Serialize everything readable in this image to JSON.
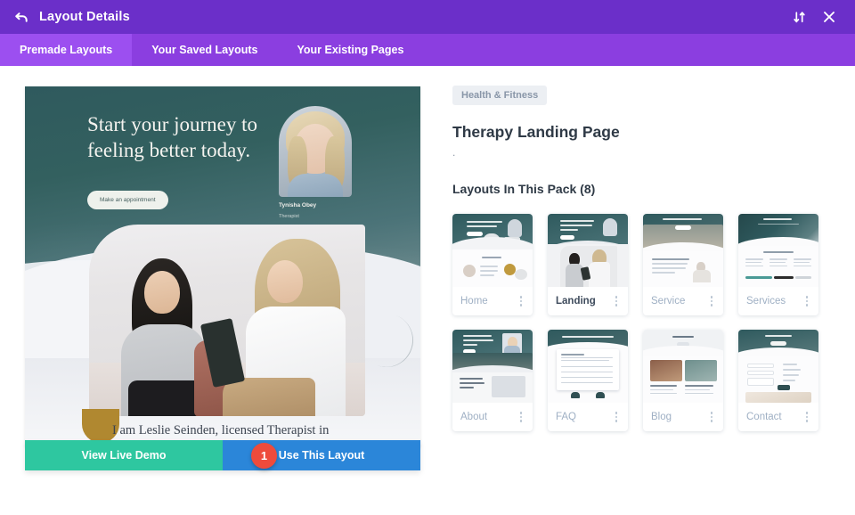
{
  "header": {
    "title": "Layout Details",
    "back_icon": "back-arrow-icon",
    "sort_icon": "sort-updown-icon",
    "close_icon": "close-x-icon",
    "bg_color": "#6b2fc9"
  },
  "tabs": [
    {
      "label": "Premade Layouts",
      "active": true
    },
    {
      "label": "Your Saved Layouts",
      "active": false
    },
    {
      "label": "Your Existing Pages",
      "active": false
    }
  ],
  "preview": {
    "headline": "Start your journey to feeling better today.",
    "cta_label": "Make an appointment",
    "person_name": "Tynisha Obey",
    "person_role": "Therapist",
    "lower_text": "I am Leslie Seinden, licensed Therapist in"
  },
  "actions": {
    "demo_label": "View Live Demo",
    "demo_color": "#2ec7a0",
    "use_label": "Use This Layout",
    "use_color": "#2b86d9",
    "marker_number": "1",
    "marker_color": "#ee4b3c"
  },
  "details": {
    "category": "Health & Fitness",
    "title": "Therapy Landing Page",
    "description": ".",
    "pack_heading": "Layouts In This Pack (8)"
  },
  "layouts": [
    {
      "label": "Home",
      "active": false,
      "thumb": "home"
    },
    {
      "label": "Landing",
      "active": true,
      "thumb": "landing"
    },
    {
      "label": "Service",
      "active": false,
      "thumb": "service"
    },
    {
      "label": "Services",
      "active": false,
      "thumb": "services"
    },
    {
      "label": "About",
      "active": false,
      "thumb": "about"
    },
    {
      "label": "FAQ",
      "active": false,
      "thumb": "faq"
    },
    {
      "label": "Blog",
      "active": false,
      "thumb": "blog"
    },
    {
      "label": "Contact",
      "active": false,
      "thumb": "contact"
    }
  ]
}
